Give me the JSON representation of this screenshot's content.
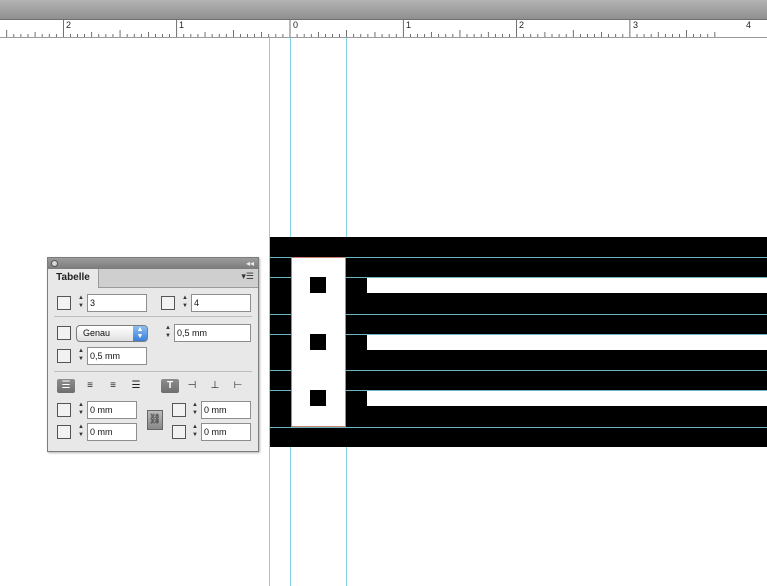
{
  "ruler": {
    "labels": [
      "2",
      "1",
      "0",
      "1",
      "2",
      "3",
      "4"
    ]
  },
  "panel": {
    "title": "Tabelle",
    "menu_icon": "panel-menu-icon",
    "rows_value": "3",
    "columns_value": "4",
    "row_height_mode": "Genau",
    "row_height_value": "0,5 mm",
    "column_width_value": "0,5 mm",
    "inset_top": "0 mm",
    "inset_bottom": "0 mm",
    "inset_left": "0 mm",
    "inset_right": "0 mm"
  },
  "colors": {
    "guide": "#7fd4e0",
    "table": "#000000",
    "accent": "#3b7fd9"
  }
}
